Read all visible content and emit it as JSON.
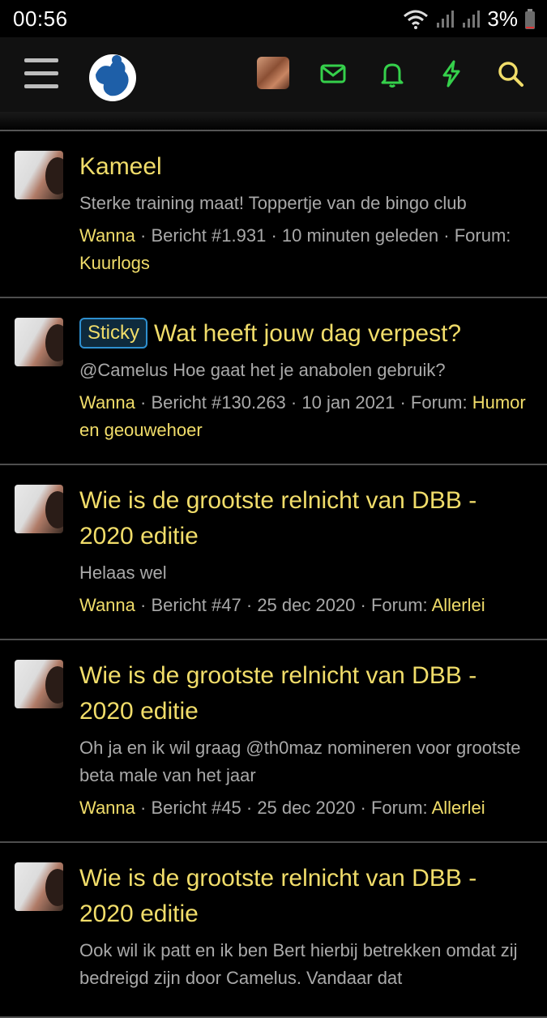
{
  "status_bar": {
    "time": "00:56",
    "battery": "3%"
  },
  "navbar": {
    "menu_icon": "hamburger-icon",
    "logo_icon": "site-logo",
    "icons": [
      "mail-icon",
      "bell-icon",
      "lightning-icon",
      "search-icon"
    ],
    "accent_color": "#35d04b",
    "search_color": "#f1dd6a"
  },
  "posts": [
    {
      "title": "Kameel",
      "sticky": "",
      "snippet": "Sterke training maat! Toppertje van de bingo club",
      "author": "Wanna",
      "post_number": "Bericht #1.931",
      "time": "10 minuten geleden",
      "forum_label": "Forum:",
      "forum": "Kuurlogs"
    },
    {
      "title": "Wat heeft jouw dag verpest?",
      "sticky": "Sticky",
      "snippet": "@Camelus Hoe gaat het je anabolen gebruik?",
      "author": "Wanna",
      "post_number": "Bericht #130.263",
      "time": "10 jan 2021",
      "forum_label": "Forum:",
      "forum": "Humor en geouwehoer"
    },
    {
      "title": "Wie is de grootste relnicht van DBB - 2020 editie",
      "sticky": "",
      "snippet": "Helaas wel",
      "author": "Wanna",
      "post_number": "Bericht #47",
      "time": "25 dec 2020",
      "forum_label": "Forum:",
      "forum": "Allerlei"
    },
    {
      "title": "Wie is de grootste relnicht van DBB - 2020 editie",
      "sticky": "",
      "snippet": "Oh ja en ik wil graag @th0maz nomineren voor grootste beta male van het jaar",
      "author": "Wanna",
      "post_number": "Bericht #45",
      "time": "25 dec 2020",
      "forum_label": "Forum:",
      "forum": "Allerlei"
    },
    {
      "title": "Wie is de grootste relnicht van DBB - 2020 editie",
      "sticky": "",
      "snippet": "Ook wil ik patt en ik ben Bert hierbij betrekken omdat zij bedreigd zijn door Camelus. Vandaar dat",
      "author": "",
      "post_number": "",
      "time": "",
      "forum_label": "",
      "forum": ""
    }
  ]
}
